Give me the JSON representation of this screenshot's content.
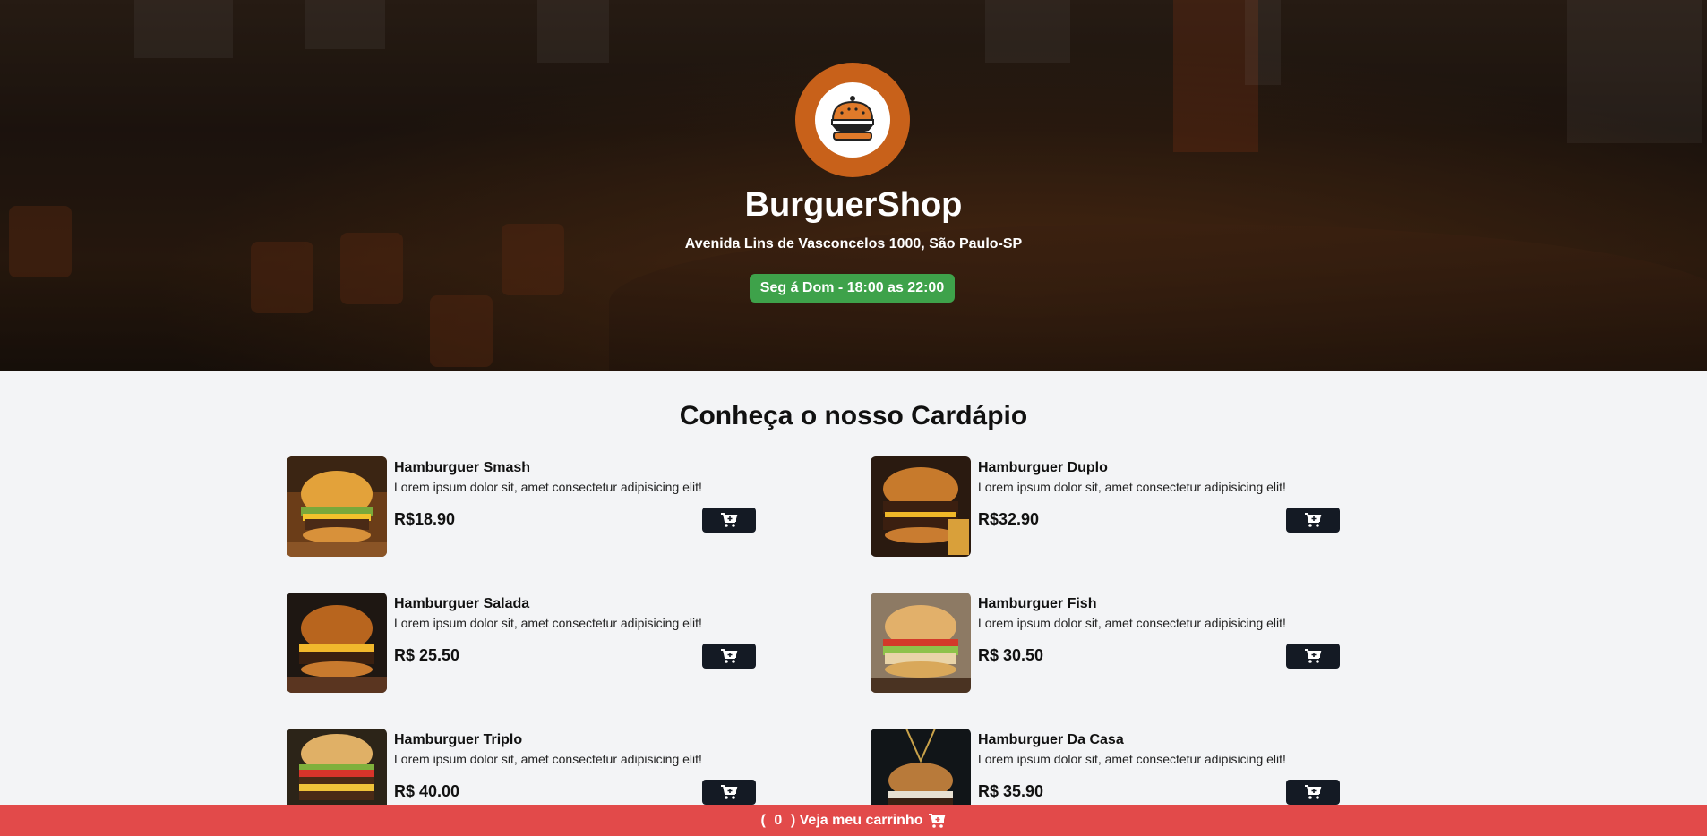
{
  "hero": {
    "shop_name": "BurguerShop",
    "address": "Avenida Lins de Vasconcelos 1000, São Paulo-SP",
    "hours": "Seg á Dom - 18:00 as 22:00",
    "logo_icon": "burger-logo-icon"
  },
  "menu": {
    "title": "Conheça o nosso Cardápio",
    "items": [
      {
        "name": "Hamburguer Smash",
        "description": "Lorem ipsum dolor sit, amet consectetur adipisicing elit!",
        "price": "R$18.90"
      },
      {
        "name": "Hamburguer Duplo",
        "description": "Lorem ipsum dolor sit, amet consectetur adipisicing elit!",
        "price": "R$32.90"
      },
      {
        "name": "Hamburguer Salada",
        "description": "Lorem ipsum dolor sit, amet consectetur adipisicing elit!",
        "price": "R$ 25.50"
      },
      {
        "name": "Hamburguer Fish",
        "description": "Lorem ipsum dolor sit, amet consectetur adipisicing elit!",
        "price": "R$ 30.50"
      },
      {
        "name": "Hamburguer Triplo",
        "description": "Lorem ipsum dolor sit, amet consectetur adipisicing elit!",
        "price": "R$ 40.00"
      },
      {
        "name": "Hamburguer Da Casa",
        "description": "Lorem ipsum dolor sit, amet consectetur adipisicing elit!",
        "price": "R$ 35.90"
      }
    ],
    "add_icon": "cart-plus-icon"
  },
  "cart": {
    "open_paren": "(",
    "count": "0",
    "label": ") Veja meu carrinho",
    "icon": "cart-plus-icon"
  },
  "colors": {
    "accent": "#c8611a",
    "hours_badge": "#3ea24a",
    "cart_bar": "#e24a4a",
    "button": "#141a24"
  }
}
